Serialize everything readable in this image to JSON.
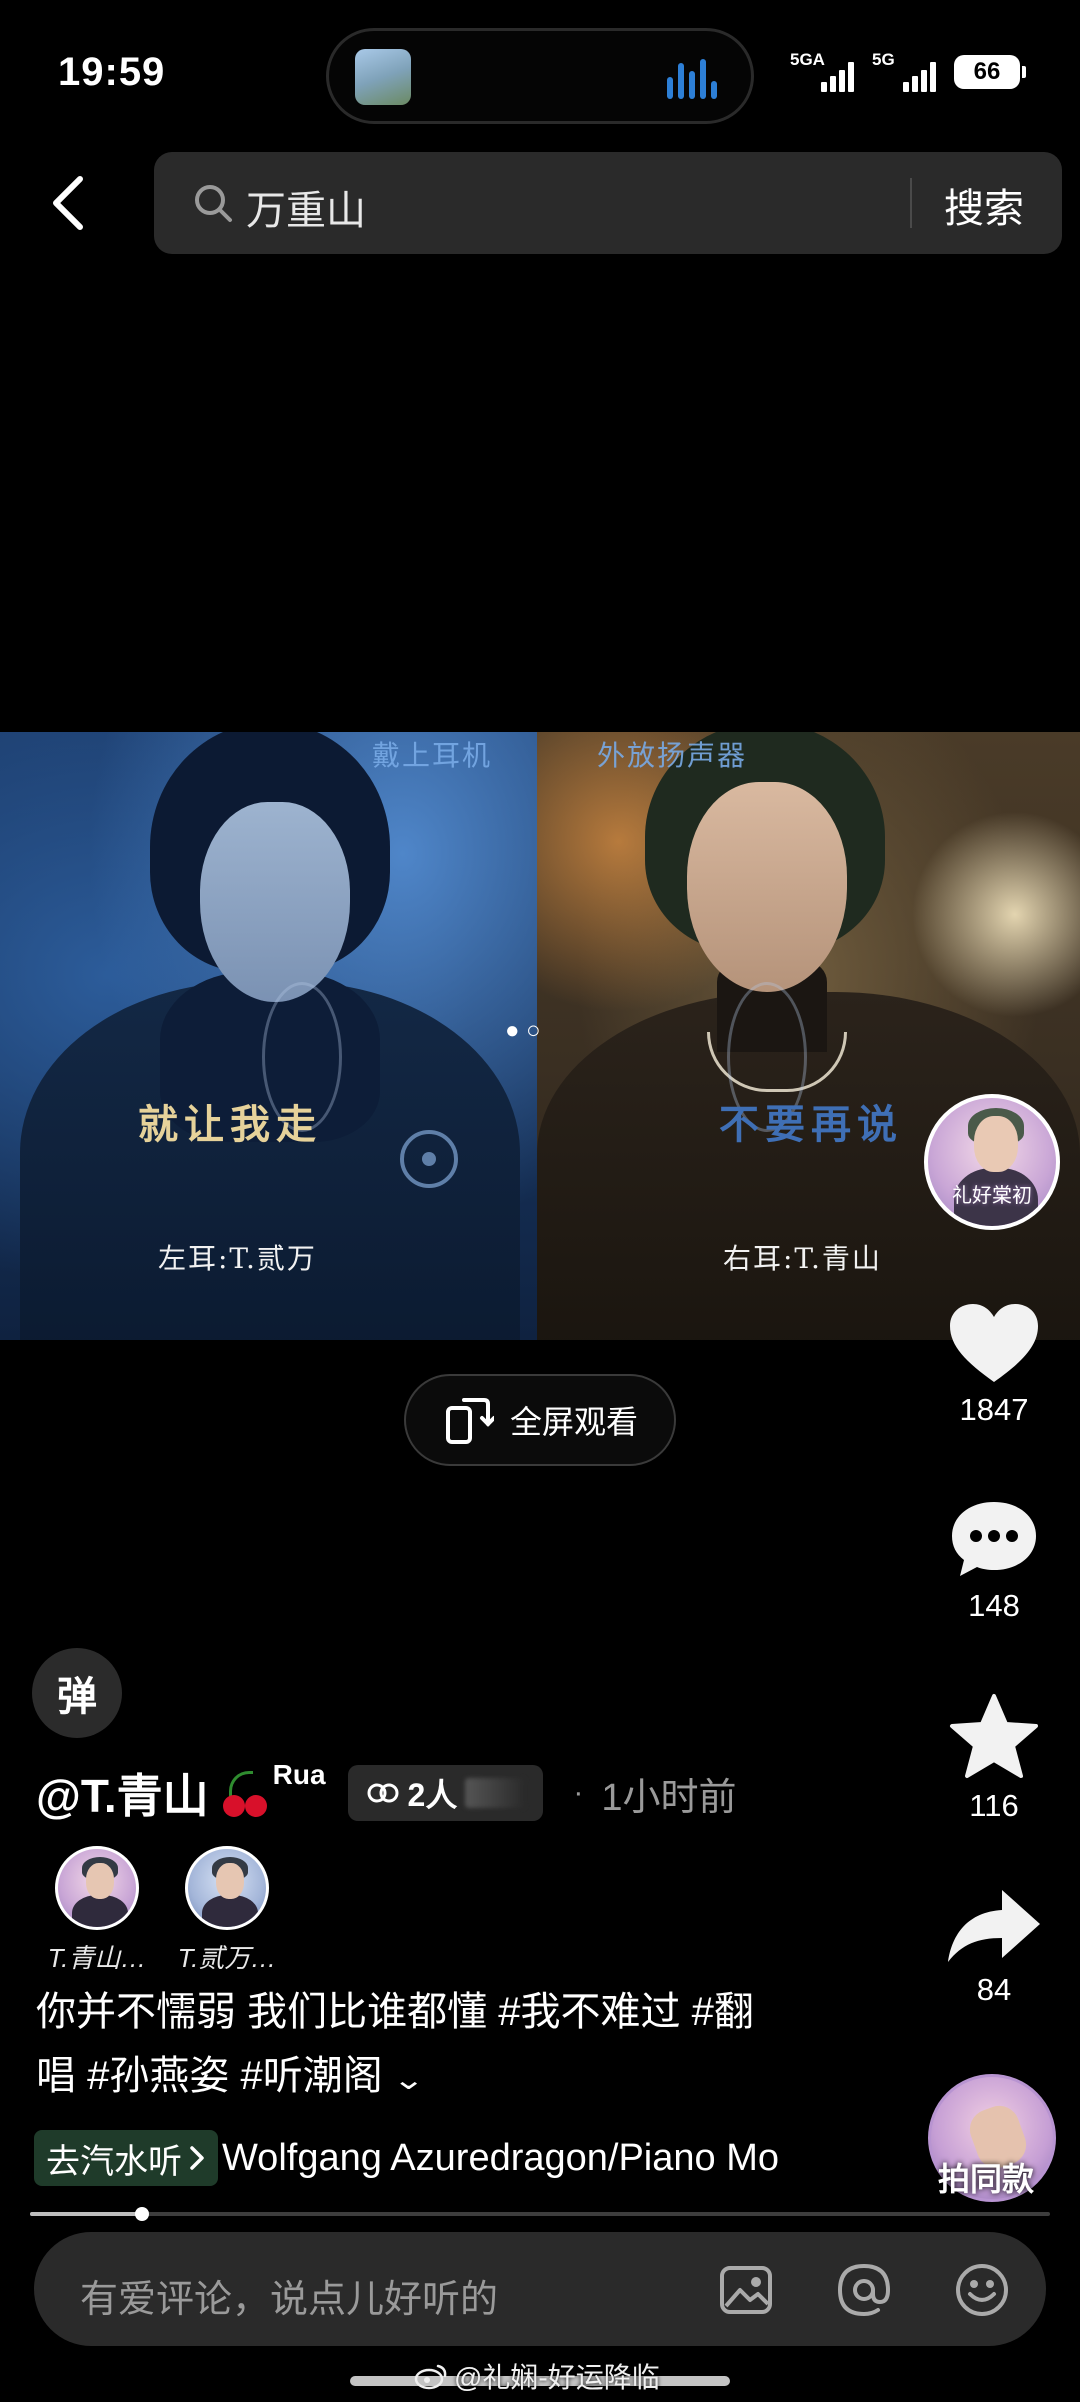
{
  "status": {
    "time": "19:59",
    "network1": "5GA",
    "network2": "5G",
    "battery": "66"
  },
  "search": {
    "query": "万重山",
    "button": "搜索"
  },
  "video": {
    "overlay_top_left": "戴上耳机",
    "overlay_top_right": "外放扬声器",
    "left_lyric": "就让我走",
    "right_lyric": "不要再说",
    "left_ear": "左耳:T.贰万",
    "right_ear": "右耳:T.青山"
  },
  "author_avatar_text": "礼好棠初",
  "actions": {
    "like_count": "1847",
    "comment_count": "148",
    "favorite_count": "116",
    "share_count": "84",
    "same_style": "拍同款"
  },
  "fullscreen": "全屏观看",
  "danmu": "弹",
  "post": {
    "author": "@T.青山",
    "author_suffix": "Rua",
    "collab": "2人",
    "separator": "·",
    "time_ago": "1小时前",
    "cocreators": [
      {
        "name": "T.青山…"
      },
      {
        "name": "T.贰万…"
      }
    ],
    "caption_line1": "你并不懦弱 我们比谁都懂 #我不难过 #翻",
    "caption_line2": "唱 #孙燕姿 #听潮阁",
    "music_tag": "去汽水听",
    "music_text": "Wolfgang Azuredragon/Piano Mo"
  },
  "progress": 0.11,
  "comment": {
    "placeholder": "有爱评论，说点儿好听的"
  },
  "watermark": "@礼娴-好运降临",
  "icons": [
    "back-icon",
    "search-icon",
    "heart-icon",
    "comment-icon",
    "star-icon",
    "share-icon",
    "image-icon",
    "at-icon",
    "emoji-icon",
    "fullscreen-icon",
    "collab-icon",
    "chevron-down-icon",
    "chevron-right-icon",
    "weibo-icon"
  ]
}
